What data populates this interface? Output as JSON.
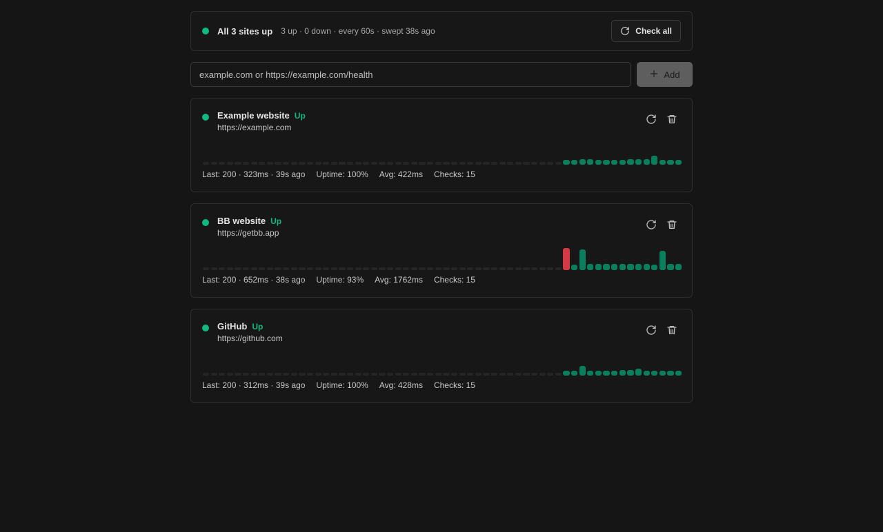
{
  "summary": {
    "title": "All 3 sites up",
    "stats": "3 up · 0 down · every 60s · swept 38s ago",
    "check_all_label": "Check all",
    "status_color": "#10b981"
  },
  "add": {
    "placeholder": "example.com or https://example.com/health",
    "button_label": "Add"
  },
  "sites": [
    {
      "name": "Example website",
      "status": "Up",
      "url": "https://example.com",
      "last": "Last: 200 · 323ms · 39s ago",
      "uptime": "Uptime: 100%",
      "avg": "Avg: 422ms",
      "checks": "Checks: 15",
      "history": [
        {
          "ms": 330,
          "ok": true
        },
        {
          "ms": 330,
          "ok": true
        },
        {
          "ms": 360,
          "ok": true
        },
        {
          "ms": 400,
          "ok": true
        },
        {
          "ms": 340,
          "ok": true
        },
        {
          "ms": 330,
          "ok": true
        },
        {
          "ms": 330,
          "ok": true
        },
        {
          "ms": 330,
          "ok": true
        },
        {
          "ms": 480,
          "ok": true
        },
        {
          "ms": 580,
          "ok": true
        },
        {
          "ms": 450,
          "ok": true
        },
        {
          "ms": 1650,
          "ok": true
        },
        {
          "ms": 330,
          "ok": true
        },
        {
          "ms": 330,
          "ok": true
        },
        {
          "ms": 323,
          "ok": true
        }
      ]
    },
    {
      "name": "BB website",
      "status": "Up",
      "url": "https://getbb.app",
      "last": "Last: 200 · 652ms · 38s ago",
      "uptime": "Uptime: 93%",
      "avg": "Avg: 1762ms",
      "checks": "Checks: 15",
      "history": [
        {
          "ms": 6200,
          "ok": false
        },
        {
          "ms": 450,
          "ok": true
        },
        {
          "ms": 5800,
          "ok": true
        },
        {
          "ms": 650,
          "ok": true
        },
        {
          "ms": 650,
          "ok": true
        },
        {
          "ms": 650,
          "ok": true
        },
        {
          "ms": 650,
          "ok": true
        },
        {
          "ms": 650,
          "ok": true
        },
        {
          "ms": 650,
          "ok": true
        },
        {
          "ms": 650,
          "ok": true
        },
        {
          "ms": 650,
          "ok": true
        },
        {
          "ms": 450,
          "ok": true
        },
        {
          "ms": 5200,
          "ok": true
        },
        {
          "ms": 650,
          "ok": true
        },
        {
          "ms": 652,
          "ok": true
        }
      ]
    },
    {
      "name": "GitHub",
      "status": "Up",
      "url": "https://github.com",
      "last": "Last: 200 · 312ms · 39s ago",
      "uptime": "Uptime: 100%",
      "avg": "Avg: 428ms",
      "checks": "Checks: 15",
      "history": [
        {
          "ms": 310,
          "ok": true
        },
        {
          "ms": 340,
          "ok": true
        },
        {
          "ms": 1950,
          "ok": true
        },
        {
          "ms": 330,
          "ok": true
        },
        {
          "ms": 330,
          "ok": true
        },
        {
          "ms": 330,
          "ok": true
        },
        {
          "ms": 330,
          "ok": true
        },
        {
          "ms": 430,
          "ok": true
        },
        {
          "ms": 380,
          "ok": true
        },
        {
          "ms": 850,
          "ok": true
        },
        {
          "ms": 330,
          "ok": true
        },
        {
          "ms": 330,
          "ok": true
        },
        {
          "ms": 330,
          "ok": true
        },
        {
          "ms": 330,
          "ok": true
        },
        {
          "ms": 312,
          "ok": true
        }
      ]
    }
  ]
}
